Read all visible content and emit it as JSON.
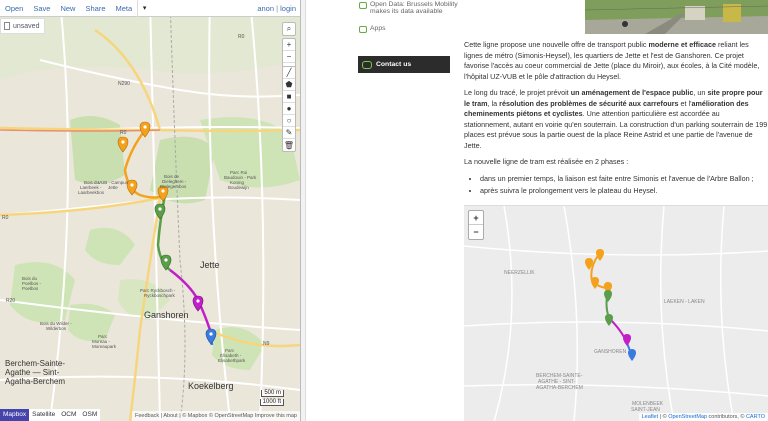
{
  "editor": {
    "menu": [
      "Open",
      "Save",
      "New",
      "Share",
      "Meta"
    ],
    "caret": "▾",
    "user_anon": "anon",
    "user_sep": "|",
    "user_login": "login",
    "unsaved_label": "unsaved",
    "map_labels": {
      "ring": "R0",
      "n290": "N290",
      "jette": "Jette",
      "ganshoren": "Ganshoren",
      "berchem": "Berchem-Sainte-\nAgathe — Sint-\nAgatha-Berchem",
      "koekelberg": "Koekelberg",
      "bois_laerbeek": "Bois du\nLaerbeek - \nLaarbeekbos",
      "vub": "VUB - Campus\nJette",
      "bois_dieleghem": "Bois de\nDieleghem - \nDielegembos",
      "parc_roi": "Parc Roi\nBaudouin - Park\nKoning\nBoudewijn",
      "bois_poelbos": "Bois du\nPoelbos -\nPoelbos",
      "bois_wilder": "Bois du Wilder -\nWilderbos",
      "parc_moreau": "Parc\nMoreau -\nMoreaupark",
      "parc_elisabeth": "Parc\nÉlisabeth -\nElisabethpark",
      "ryckbosch": "Parc Ryckbosch -\nRyckboschpark",
      "r0_2": "R0",
      "r20": "R20",
      "n9": "N9"
    },
    "scale_500m": "500 m",
    "scale_1000ft": "1000 ft",
    "layers": [
      "Mapbox",
      "Satellite",
      "OCM",
      "OSM"
    ],
    "active_layer": "Mapbox",
    "attribution": "Feedback | About | © Mapbox © OpenStreetMap Improve this map",
    "zoom_in": "+",
    "zoom_out": "−"
  },
  "article": {
    "open_data_title": "Open Data: Brussels Mobility",
    "open_data_sub": "makes its data available",
    "apps": "Apps",
    "contact": "Contact us",
    "p1": "Cette ligne propose une nouvelle offre de transport public moderne et efficace reliant les lignes de métro (Simonis-Heysel), les quartiers de Jette et l'est de Ganshoren. Ce projet favorise l'accès au coeur commercial de Jette (place du Miroir), aux écoles, à la Cité modèle, l'hôpital UZ-VUB et le pôle d'attraction du Heysel.",
    "p2": "Le long du tracé, le projet prévoit un aménagement de l'espace public, un site propre pour le tram, la résolution des problèmes de sécurité aux carrefours et l'amélioration des cheminements piétons et cyclistes. Une attention particulière est accordée au stationnement, autant en voirie qu'en souterrain. La construction d'un parking souterrain de 199 places est prévue sous la partie ouest de la place Reine Astrid et une partie de l'avenue de Jette.",
    "p3": "La nouvelle ligne de tram est réalisée en 2 phases :",
    "li1": "dans un premier temps, la liaison est faite entre Simonis et l'avenue de l'Arbre Ballon ;",
    "li2": "après suivra le prolongement vers le plateau du Heysel.",
    "mm_zoom_in": "+",
    "mm_zoom_out": "−",
    "mm_labels": {
      "neerzellik": "NEERZELLIK",
      "laeken": "LAEKEN - LAKEN",
      "ganshoren": "GANSHOREN",
      "berchem": "BERCHEM-SAINTE-\nAGATHE - SINT-\nAGATHA-BERCHEM",
      "molenbeek": "MOLENBEEK\nSAINT-JEAN"
    },
    "mm_attrib_leaflet": "Leaflet",
    "mm_attrib_osm": "OpenStreetMap",
    "mm_attrib_carto": "CARTO",
    "mm_attrib_text": " | © ",
    "mm_attrib_contrib": " contributors, © "
  },
  "route": {
    "colors": {
      "orange": "#f4a21c",
      "green": "#5a9e4b",
      "purple": "#c11fc7",
      "blue": "#3a7be0"
    }
  }
}
